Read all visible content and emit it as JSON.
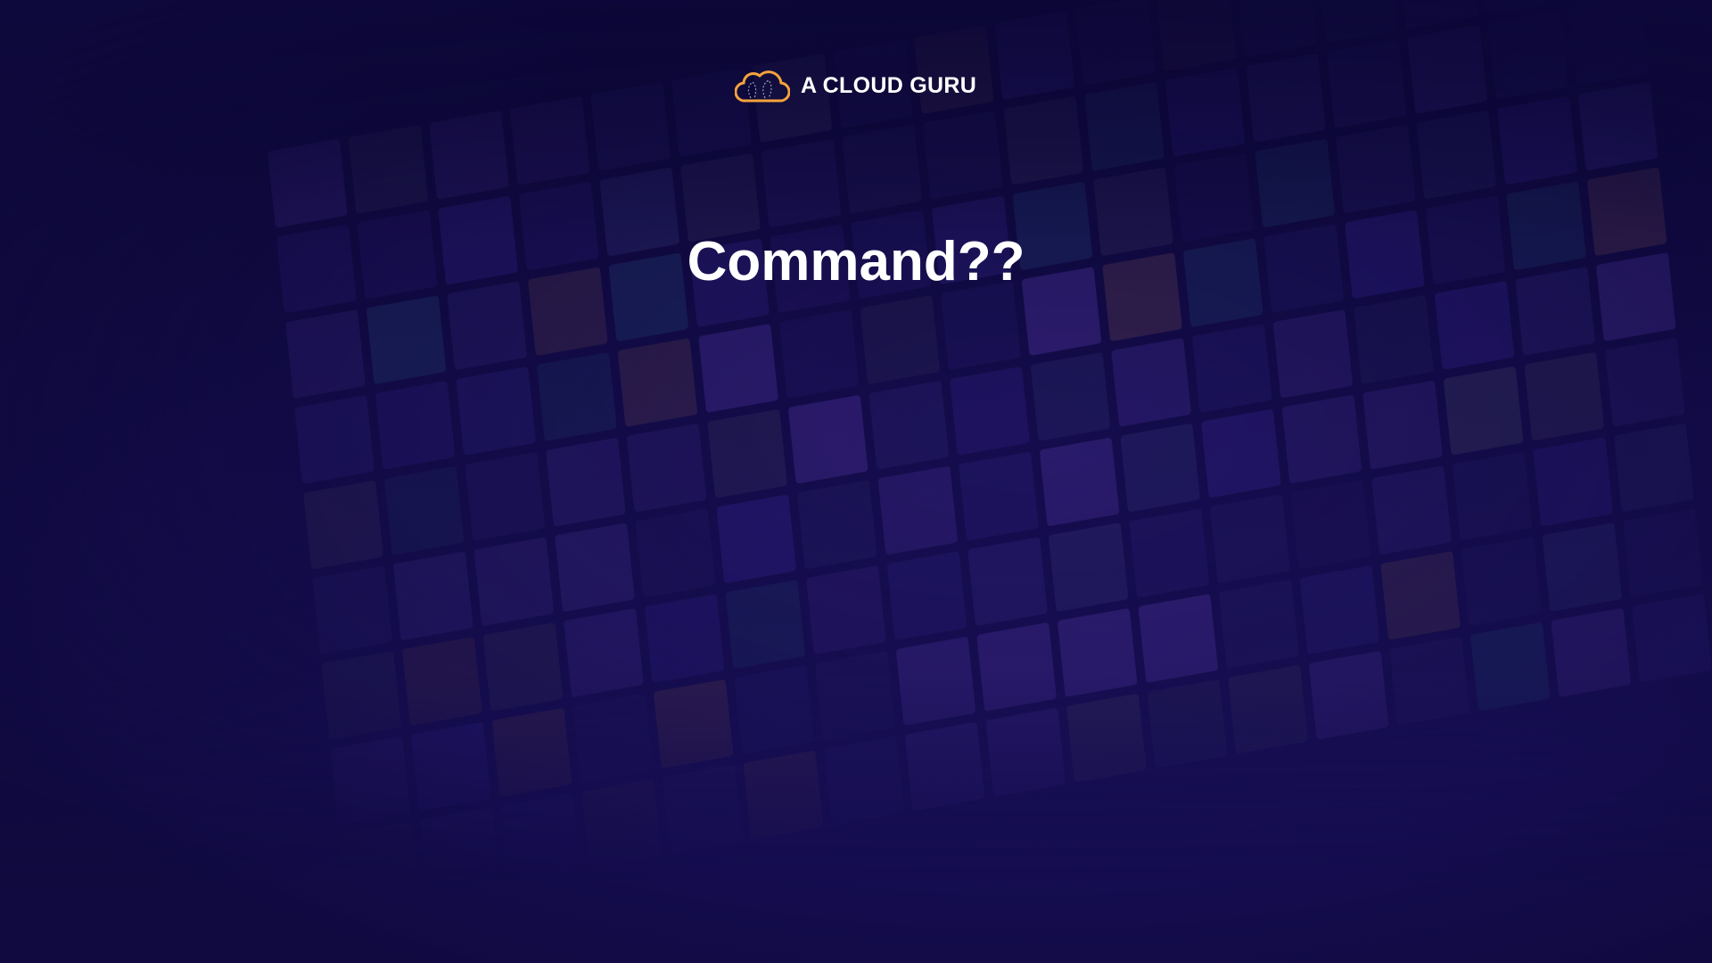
{
  "brand": {
    "name": "A CLOUD GURU",
    "logo_icon": "cloud-icon",
    "accent": "#f5a33b"
  },
  "slide": {
    "title": "Command??"
  },
  "colors": {
    "background_top": "#0c0736",
    "background_bottom": "#1b1160"
  }
}
